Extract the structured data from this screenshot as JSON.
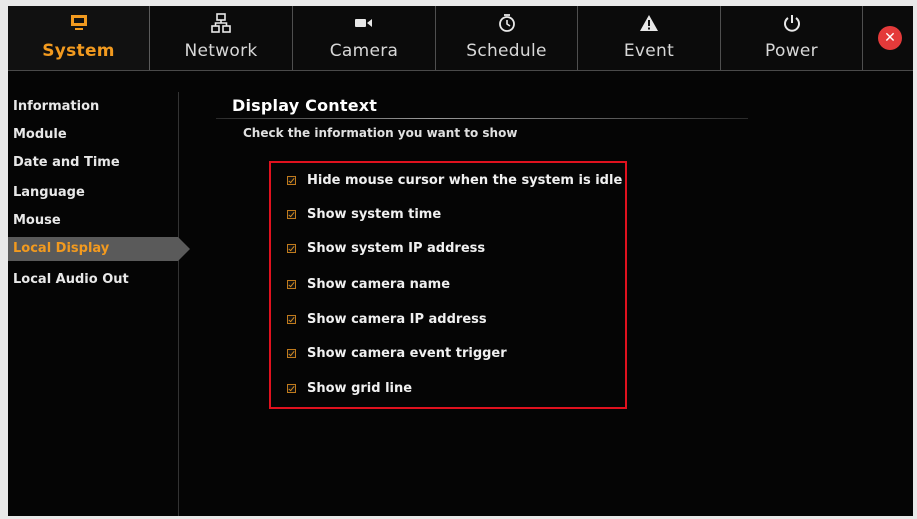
{
  "nav": {
    "tabs": [
      {
        "id": "system",
        "label": "System",
        "icon": "monitor-icon",
        "active": true
      },
      {
        "id": "network",
        "label": "Network",
        "icon": "network-icon",
        "active": false
      },
      {
        "id": "camera",
        "label": "Camera",
        "icon": "camera-icon",
        "active": false
      },
      {
        "id": "schedule",
        "label": "Schedule",
        "icon": "clock-icon",
        "active": false
      },
      {
        "id": "event",
        "label": "Event",
        "icon": "warning-icon",
        "active": false
      },
      {
        "id": "power",
        "label": "Power",
        "icon": "power-icon",
        "active": false
      }
    ],
    "close_icon": "✕"
  },
  "sidebar": {
    "items": [
      {
        "label": "Information",
        "active": false
      },
      {
        "label": "Module",
        "active": false
      },
      {
        "label": "Date and Time",
        "active": false
      },
      {
        "label": "Language",
        "active": false
      },
      {
        "label": "Mouse",
        "active": false
      },
      {
        "label": "Local Display",
        "active": true
      },
      {
        "label": "Local Audio Out",
        "active": false
      }
    ]
  },
  "main": {
    "title": "Display Context",
    "subtitle": "Check the information you want to show",
    "options": [
      {
        "label": "Hide mouse cursor when the system is idle",
        "checked": true
      },
      {
        "label": "Show system time",
        "checked": true
      },
      {
        "label": "Show system IP address",
        "checked": true
      },
      {
        "label": "Show camera name",
        "checked": true
      },
      {
        "label": "Show camera IP address",
        "checked": true
      },
      {
        "label": "Show camera event trigger",
        "checked": true
      },
      {
        "label": "Show grid line",
        "checked": true
      }
    ]
  },
  "colors": {
    "accent": "#f29a1f",
    "highlight_border": "#e0111e",
    "background": "#050505",
    "active_sidebar_bg": "#5a5a5a"
  }
}
